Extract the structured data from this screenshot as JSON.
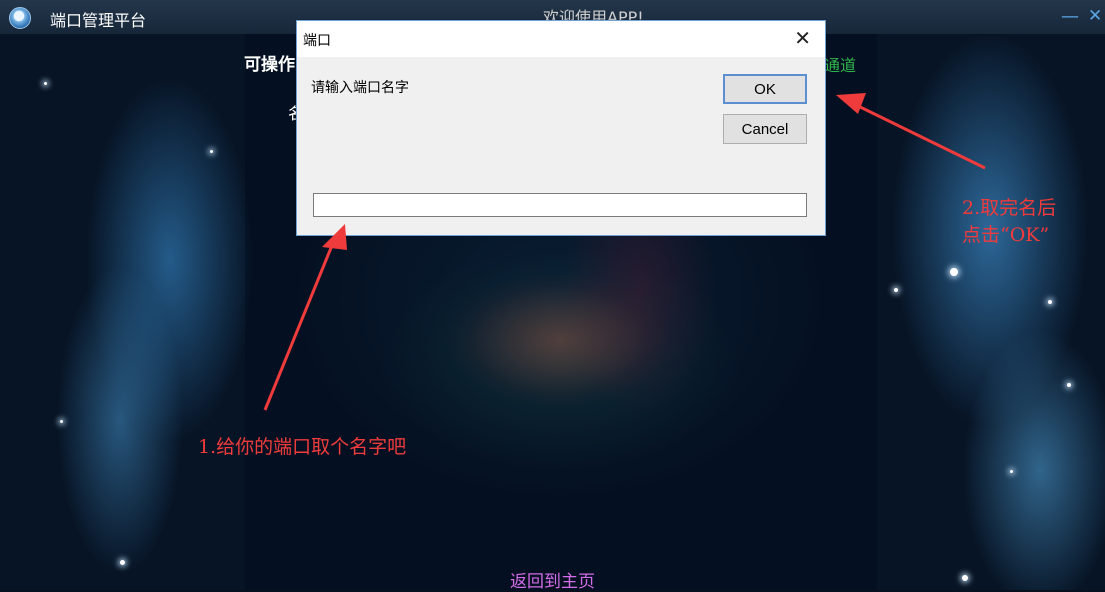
{
  "app": {
    "title": "端口管理平台",
    "welcome": "欢迎使用APP!",
    "minimize_glyph": "—",
    "close_glyph": "✕"
  },
  "background_ui": {
    "left_label": "可操作",
    "left_label2": "名",
    "right_label": "通道",
    "back_home": "返回到主页"
  },
  "dialog": {
    "title": "端口",
    "close_glyph": "✕",
    "prompt": "请输入端口名字",
    "ok_label": "OK",
    "cancel_label": "Cancel",
    "input_value": "",
    "input_placeholder": ""
  },
  "annotations": {
    "step1": "1.给你的端口取个名字吧",
    "step2_line1": "2.取完名后",
    "step2_line2": "点击“OK”",
    "color": "#ef3b3b"
  },
  "colors": {
    "titlebar": "#1c2d40",
    "back_home_link": "#d46be8",
    "channel_text": "#2fb34a",
    "window_control": "#5aa6e6"
  }
}
